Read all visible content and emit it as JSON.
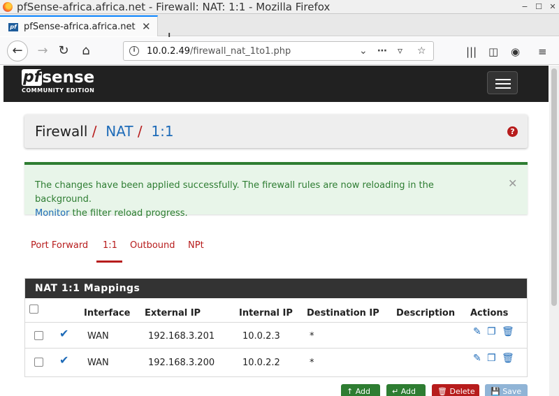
{
  "window": {
    "title": "pfSense-africa.africa.net - Firewall: NAT: 1:1 - Mozilla Firefox"
  },
  "browser": {
    "tab_title": "pfSense-africa.africa.net",
    "favicon_text": "pf",
    "url_host": "10.0.2.49",
    "url_path": "/firewall_nat_1to1.php"
  },
  "header": {
    "logo_pf": "pf",
    "logo_sense": "sense",
    "logo_sub": "COMMUNITY EDITION"
  },
  "breadcrumb": {
    "part1": "Firewall",
    "part2": "NAT",
    "part3": "1:1",
    "sep": "/"
  },
  "alert": {
    "text1": "The changes have been applied successfully. The firewall rules are now reloading in the background.",
    "link": "Monitor",
    "text2": " the filter reload progress."
  },
  "tabs": [
    {
      "label": "Port Forward",
      "active": false
    },
    {
      "label": "1:1",
      "active": true
    },
    {
      "label": "Outbound",
      "active": false
    },
    {
      "label": "NPt",
      "active": false
    }
  ],
  "table": {
    "title": "NAT 1:1 Mappings",
    "columns": [
      "Interface",
      "External IP",
      "Internal IP",
      "Destination IP",
      "Description",
      "Actions"
    ],
    "rows": [
      {
        "interface": "WAN",
        "external": "192.168.3.201",
        "internal": "10.0.2.3",
        "destination": "*",
        "description": ""
      },
      {
        "interface": "WAN",
        "external": "192.168.3.200",
        "internal": "10.0.2.2",
        "destination": "*",
        "description": ""
      }
    ]
  },
  "buttons": {
    "add_top": "Add",
    "add_bottom": "Add",
    "delete": "Delete",
    "save": "Save"
  },
  "colors": {
    "accent": "#b71c1c",
    "link": "#1e6bb8",
    "success": "#2e7d32",
    "header_bg": "#212121"
  }
}
